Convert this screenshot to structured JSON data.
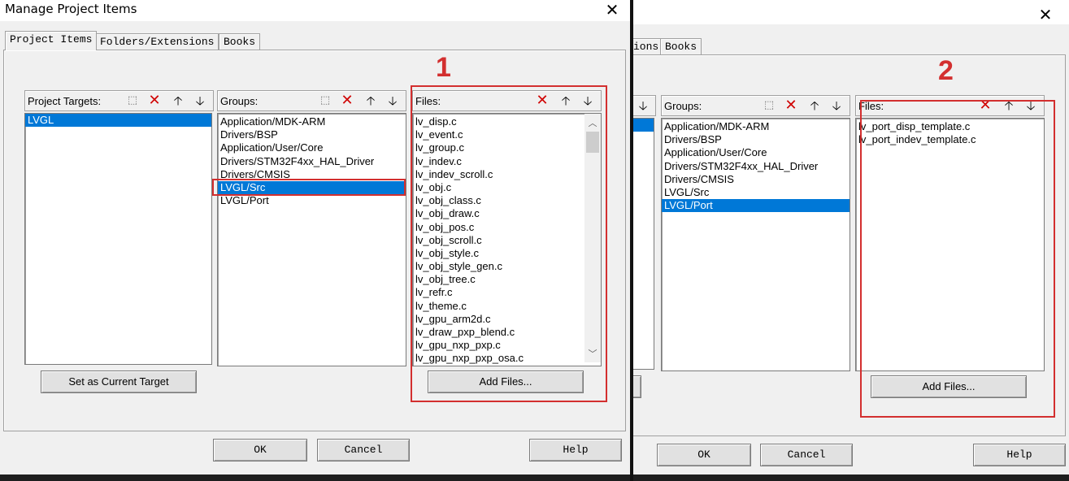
{
  "dialog1": {
    "title": "Manage Project Items",
    "close": "✕",
    "tabs": [
      "Project Items",
      "Folders/Extensions",
      "Books"
    ],
    "targets": {
      "label": "Project Targets:",
      "items": [
        "LVGL"
      ]
    },
    "groups": {
      "label": "Groups:",
      "items": [
        "Application/MDK-ARM",
        "Drivers/BSP",
        "Application/User/Core",
        "Drivers/STM32F4xx_HAL_Driver",
        "Drivers/CMSIS",
        "LVGL/Src",
        "LVGL/Port"
      ]
    },
    "files": {
      "label": "Files:",
      "items": [
        "lv_disp.c",
        "lv_event.c",
        "lv_group.c",
        "lv_indev.c",
        "lv_indev_scroll.c",
        "lv_obj.c",
        "lv_obj_class.c",
        "lv_obj_draw.c",
        "lv_obj_pos.c",
        "lv_obj_scroll.c",
        "lv_obj_style.c",
        "lv_obj_style_gen.c",
        "lv_obj_tree.c",
        "lv_refr.c",
        "lv_theme.c",
        "lv_gpu_arm2d.c",
        "lv_draw_pxp_blend.c",
        "lv_gpu_nxp_pxp.c",
        "lv_gpu_nxp_pxp_osa.c"
      ]
    },
    "set_current_target": "Set as Current Target",
    "add_files": "Add Files...",
    "ok": "OK",
    "cancel": "Cancel",
    "help": "Help",
    "annotation": "1"
  },
  "dialog2": {
    "close": "✕",
    "tab_partial": "ions",
    "tab_books": "Books",
    "groups": {
      "label": "Groups:",
      "items": [
        "Application/MDK-ARM",
        "Drivers/BSP",
        "Application/User/Core",
        "Drivers/STM32F4xx_HAL_Driver",
        "Drivers/CMSIS",
        "LVGL/Src",
        "LVGL/Port"
      ]
    },
    "files": {
      "label": "Files:",
      "items": [
        "lv_port_disp_template.c",
        "lv_port_indev_template.c"
      ]
    },
    "add_files": "Add Files...",
    "ok": "OK",
    "cancel": "Cancel",
    "help": "Help",
    "annotation": "2"
  },
  "icons": {
    "new": "new-item-icon",
    "delete": "delete-icon",
    "up": "move-up-icon",
    "down": "move-down-icon"
  },
  "colors": {
    "selection": "#0078d7",
    "annotation": "#d32f2f"
  }
}
